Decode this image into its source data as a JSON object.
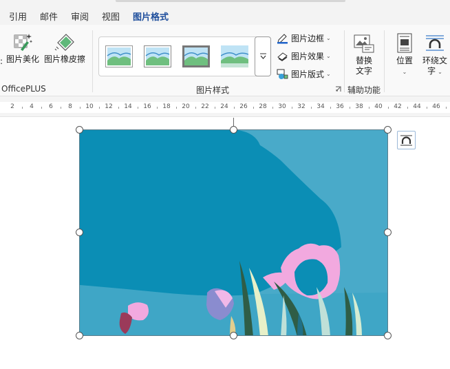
{
  "tabs": [
    {
      "id": "references",
      "label": "引用"
    },
    {
      "id": "mailings",
      "label": "邮件"
    },
    {
      "id": "review",
      "label": "审阅"
    },
    {
      "id": "view",
      "label": "视图"
    },
    {
      "id": "picture-format",
      "label": "图片格式",
      "active": true
    }
  ],
  "ribbon": {
    "officeplus": {
      "beautify_label": "图片美化",
      "eraser_label": "图片橡皮擦",
      "group_label": "OfficePLUS"
    },
    "picture_styles": {
      "group_label": "图片样式",
      "border_label": "图片边框",
      "effects_label": "图片效果",
      "layout_label": "图片版式"
    },
    "accessibility": {
      "alt_text_line1": "替换",
      "alt_text_line2": "文字",
      "group_label": "辅助功能"
    },
    "arrange": {
      "position_label": "位置",
      "wrap_line1": "环绕文",
      "wrap_line2": "字"
    }
  },
  "ruler": {
    "ticks": [
      "2",
      "4",
      "6",
      "8",
      "10",
      "12",
      "14",
      "16",
      "18",
      "20",
      "22",
      "24",
      "26",
      "28",
      "30",
      "32",
      "34",
      "36",
      "38",
      "40",
      "42",
      "44",
      "46"
    ]
  },
  "colors": {
    "accent": "#1e62c9",
    "picture_sky_light": "#49aac9",
    "picture_sky_dark": "#0b8eb5",
    "flower_pink": "#f2a9df"
  },
  "icons": {
    "caret": "⌄",
    "gallery_more": "▾"
  }
}
